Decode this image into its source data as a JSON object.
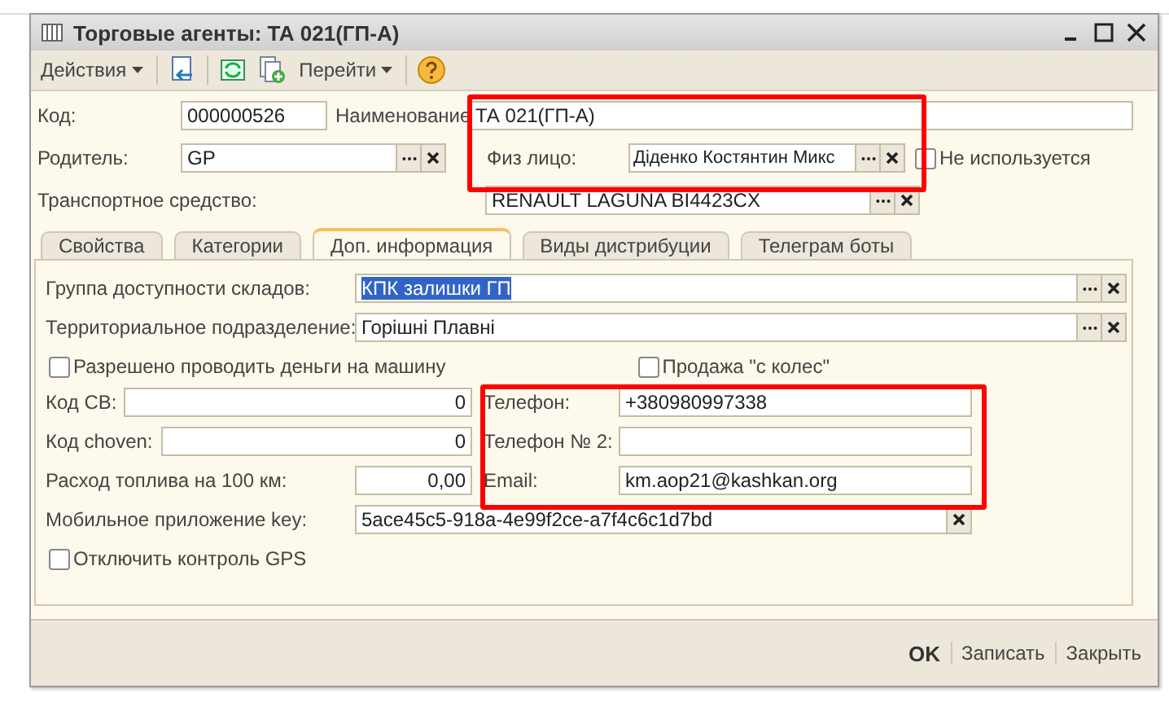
{
  "window": {
    "title": "Торговые агенты: ТА 021(ГП-А)"
  },
  "toolbar": {
    "actions_menu": "Действия",
    "goto_menu": "Перейти"
  },
  "header": {
    "code": {
      "label": "Код:",
      "value": "000000526"
    },
    "name": {
      "label": "Наименование",
      "value": "ТА 021(ГП-А)"
    },
    "parent": {
      "label": "Родитель:",
      "value": "GP"
    },
    "person": {
      "label": "Физ лицо:",
      "value": "Діденко Костянтин Микс"
    },
    "not_used": {
      "label": "Не используется",
      "checked": false
    },
    "vehicle": {
      "label": "Транспортное средство:",
      "value": "RENAULT LAGUNA BI4423CX"
    }
  },
  "tabs": [
    {
      "label": "Свойства",
      "selected": false
    },
    {
      "label": "Категории",
      "selected": false
    },
    {
      "label": "Доп. информация",
      "selected": true
    },
    {
      "label": "Виды дистрибуции",
      "selected": false
    },
    {
      "label": "Телеграм боты",
      "selected": false
    }
  ],
  "tab_panel": {
    "warehouse_group": {
      "label": "Группа доступности складов:",
      "value": "КПК залишки ГП",
      "text_selected": true
    },
    "territorial_unit": {
      "label": "Территориальное подразделение:",
      "value": "Горішні Плавні"
    },
    "allow_money": {
      "label": "Разрешено проводить деньги на машину",
      "checked": false
    },
    "wheel_sale": {
      "label": "Продажа \"с колес\"",
      "checked": false
    },
    "code_sv": {
      "label": "Код СВ:",
      "value": "0"
    },
    "code_choven": {
      "label": "Код choven:",
      "value": "0"
    },
    "fuel": {
      "label": "Расход топлива на 100 км:",
      "value": "0,00"
    },
    "phone": {
      "label": "Телефон:",
      "value": "+380980997338"
    },
    "phone2": {
      "label": "Телефон № 2:"
    },
    "email": {
      "label": "Email:",
      "value": "km.aop21@kashkan.org"
    },
    "mobile_key": {
      "label": "Мобильное приложение key:",
      "value": "5ace45c5-918a-4e99f2ce-a7f4c6c1d7bd"
    },
    "disable_gps": {
      "label": "Отключить контроль GPS",
      "checked": false
    }
  },
  "footer": [
    {
      "label": "OK",
      "default": true
    },
    {
      "label": "Записать",
      "default": false
    },
    {
      "label": "Закрыть",
      "default": false
    }
  ]
}
